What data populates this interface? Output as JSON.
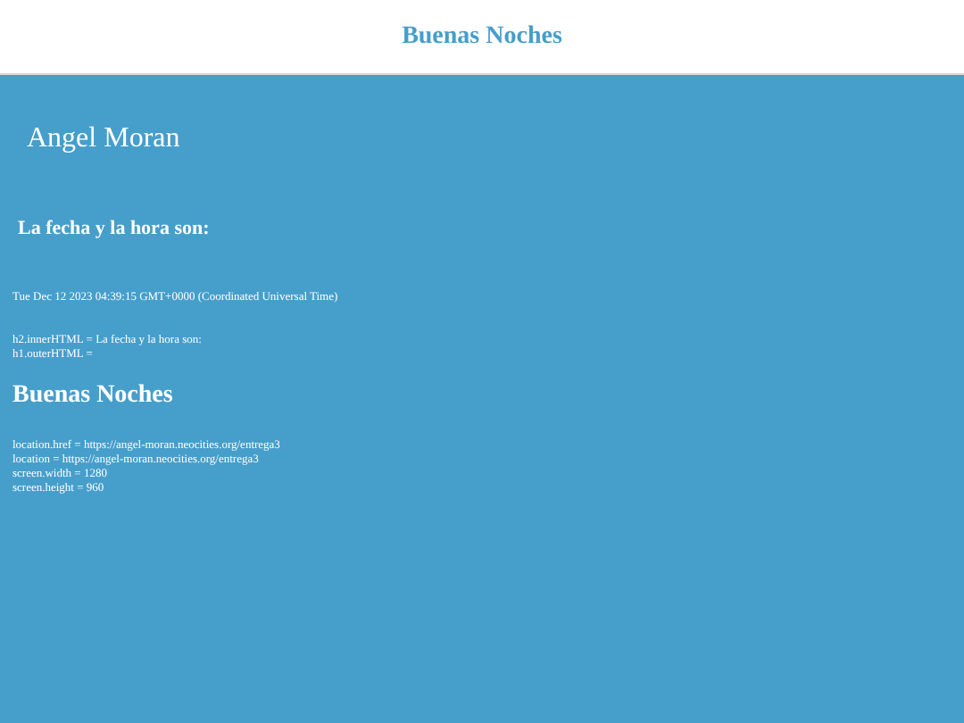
{
  "header": {
    "title": "Buenas Noches"
  },
  "name": "Angel Moran",
  "subtitle": "La fecha y la hora son:",
  "date": "Tue Dec 12 2023 04:39:15 GMT+0000 (Coordinated Universal Time)",
  "html_lines": [
    "h2.innerHTML = La fecha y la hora son:",
    "h1.outerHTML ="
  ],
  "heading": "Buenas Noches",
  "info_lines": [
    "location.href = https://angel-moran.neocities.org/entrega3",
    "location = https://angel-moran.neocities.org/entrega3",
    "screen.width = 1280",
    "screen.height = 960"
  ]
}
